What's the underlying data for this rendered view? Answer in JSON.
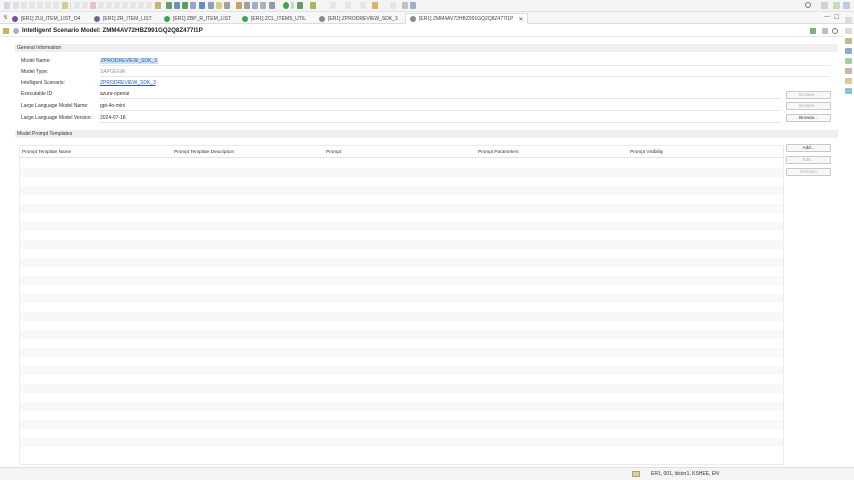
{
  "tabs": [
    {
      "label": "[ER1] ZUI_ITEM_LIST_O4",
      "color": "#7a4ea3",
      "active": false
    },
    {
      "label": "[ER1] ZR_ITEM_LIST",
      "color": "#5a6f8f",
      "active": false
    },
    {
      "label": "[ER1] ZBP_R_ITEM_LIST",
      "color": "#3aa64a",
      "active": false
    },
    {
      "label": "[ER1] ZCL_ITEMS_UTIL",
      "color": "#3aa64a",
      "active": false
    },
    {
      "label": "[ER1] ZPRODREVIEW_SDK_3",
      "color": "#8a8a8a",
      "active": false
    },
    {
      "label": "[ER1] ZMM4AV72HBZ991GQ2Q8Z477I1P",
      "color": "#8a8a8a",
      "active": true
    }
  ],
  "editor": {
    "title": "Intelligent Scenario Model: ZMM4AV72HBZ991GQ2Q8Z477I1P"
  },
  "general": {
    "heading": "General Information",
    "model_name_label": "Model Name:",
    "model_name_value": "ZPRODREVIEW_SDK_3",
    "model_type_label": "Model Type:",
    "model_type_value": "SAPGENAI",
    "scenario_label": "Intelligent Scenario:",
    "scenario_value": "ZPRODREVIEW_SDK_3",
    "exec_id_label": "Executable ID:",
    "exec_id_value": "azure-openai",
    "llm_name_label": "Large Language Model Name:",
    "llm_name_value": "gpt-4o-mini",
    "llm_version_label": "Large Language Model Version:",
    "llm_version_value": "2024-07-18",
    "browse_label": "Browse..."
  },
  "templates": {
    "heading": "Model Prompt Templates",
    "columns": [
      "Prompt Template Name",
      "Prompt Template Description",
      "Prompt",
      "Prompt Parameters",
      "Prompt Visibility"
    ],
    "add_label": "Add...",
    "edit_label": "Edit...",
    "remove_label": "Remove"
  },
  "status": {
    "text": "ER1, 001, ldcier1, KSHEE, EN"
  }
}
